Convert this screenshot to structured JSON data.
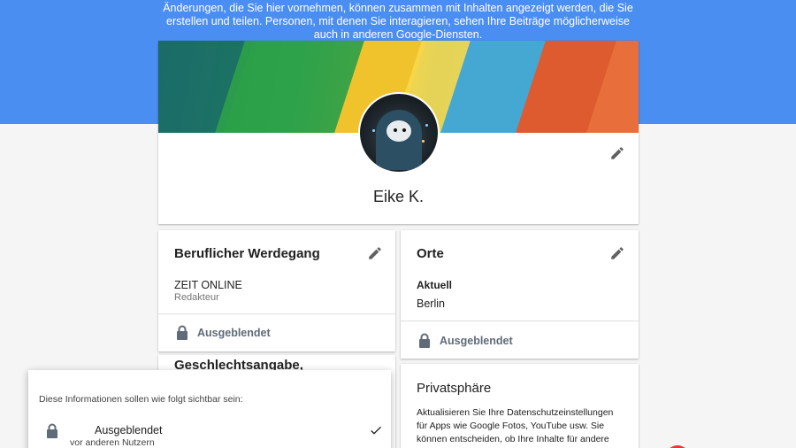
{
  "banner": {
    "text": "Änderungen, die Sie hier vornehmen, können zusammen mit Inhalten angezeigt werden, die Sie erstellen und teilen. Personen, mit denen Sie interagieren, sehen Ihre Beiträge möglicherweise auch in anderen Google-Diensten."
  },
  "profile": {
    "name": "Eike K."
  },
  "career": {
    "title": "Beruflicher Werdegang",
    "company": "ZEIT ONLINE",
    "role": "Redakteur",
    "visibility": "Ausgeblendet"
  },
  "places": {
    "title": "Orte",
    "current_label": "Aktuell",
    "current_value": "Berlin",
    "visibility": "Ausgeblendet"
  },
  "gender": {
    "title": "Geschlechtsangabe,"
  },
  "privacy": {
    "title": "Privatsphäre",
    "text_line1": "Aktualisieren Sie Ihre Datenschutzeinstellungen",
    "text_line2": "für Apps wie Google Fotos, YouTube usw. Sie",
    "text_line3": "können entscheiden, ob Ihre Inhalte für andere"
  },
  "visibility_popup": {
    "heading": "Diese Informationen sollen wie folgt sichtbar sein:",
    "option_label": "Ausgeblendet",
    "option_sub": "vor anderen Nutzern"
  },
  "colors": {
    "header_blue": "#4b8ef1",
    "background": "#f5f5f5",
    "lock_gray": "#5f6b78",
    "fab_red": "#e53935"
  },
  "icons": [
    "edit-icon",
    "lock-icon",
    "check-icon"
  ]
}
